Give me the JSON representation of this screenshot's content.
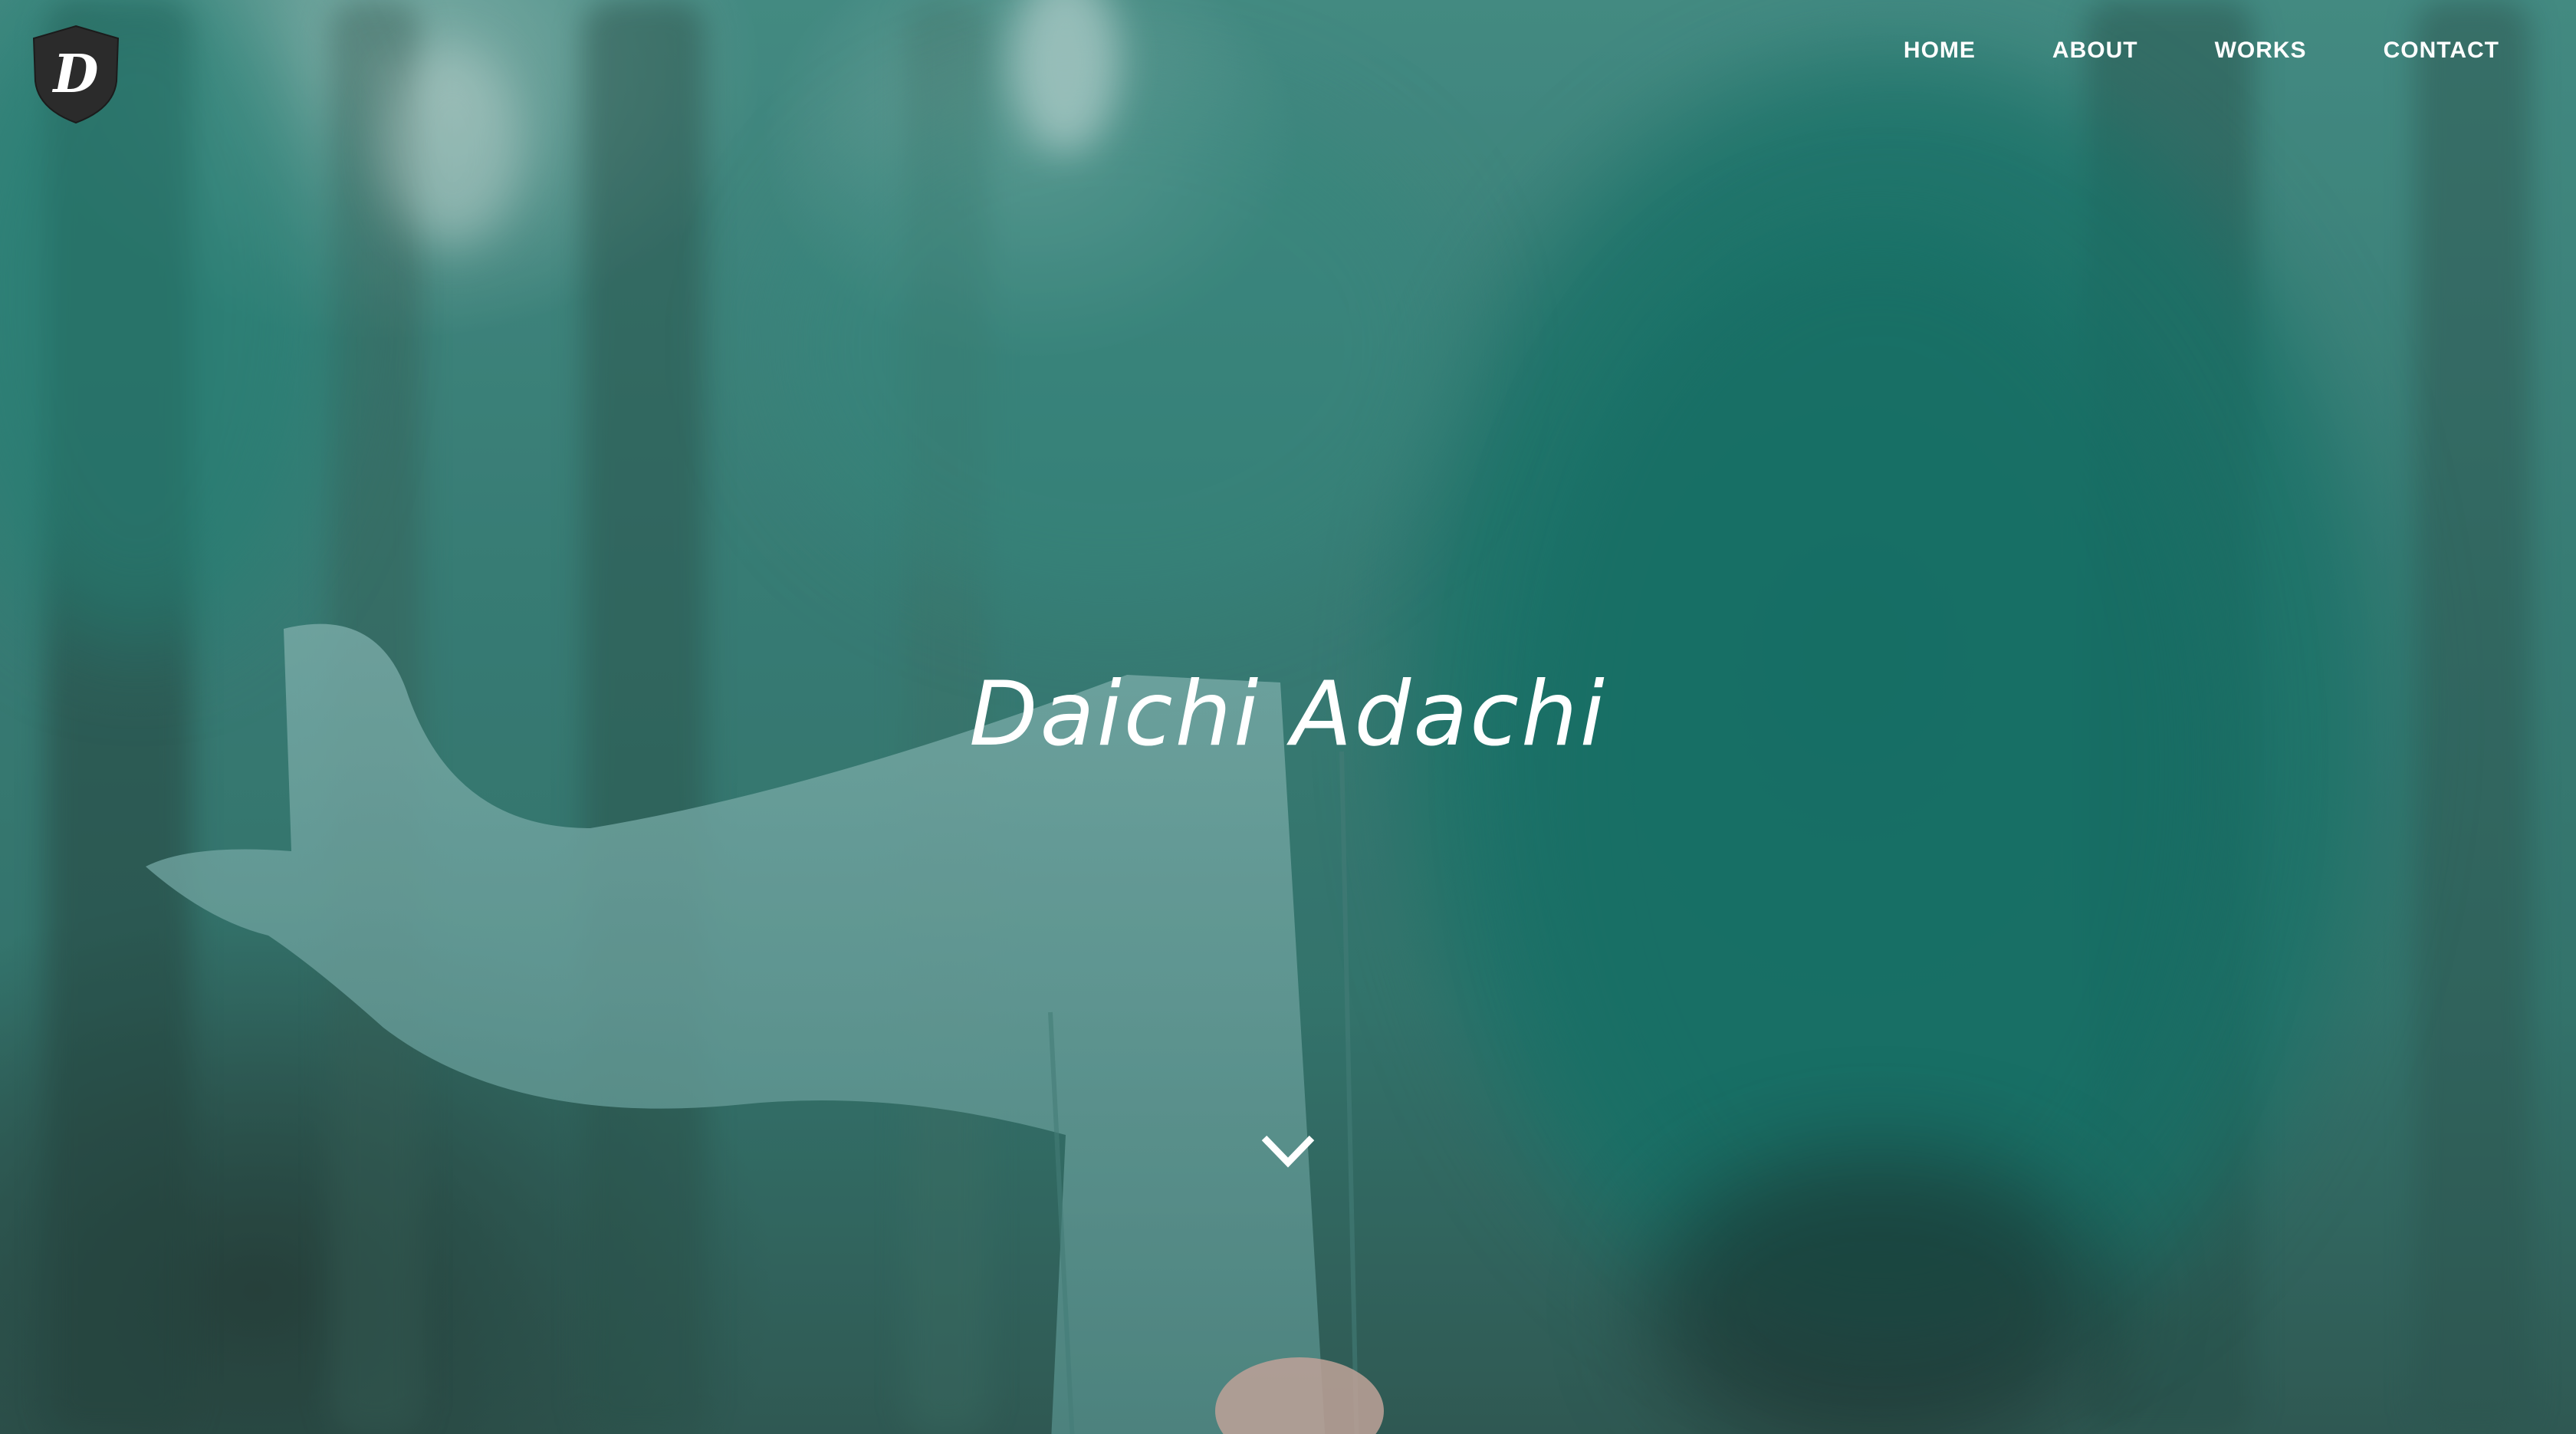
{
  "site": {
    "logo_letter": "D",
    "logo_icon": "shield-logo-icon"
  },
  "nav": {
    "items": [
      {
        "label": "HOME"
      },
      {
        "label": "ABOUT"
      },
      {
        "label": "WORKS"
      },
      {
        "label": "CONTACT"
      }
    ]
  },
  "hero": {
    "title": "Daichi Adachi",
    "scroll_icon": "chevron-down-icon"
  },
  "colors": {
    "background_teal": "#3f8a82",
    "text": "#ffffff",
    "logo_fill": "#2b2b2b"
  }
}
